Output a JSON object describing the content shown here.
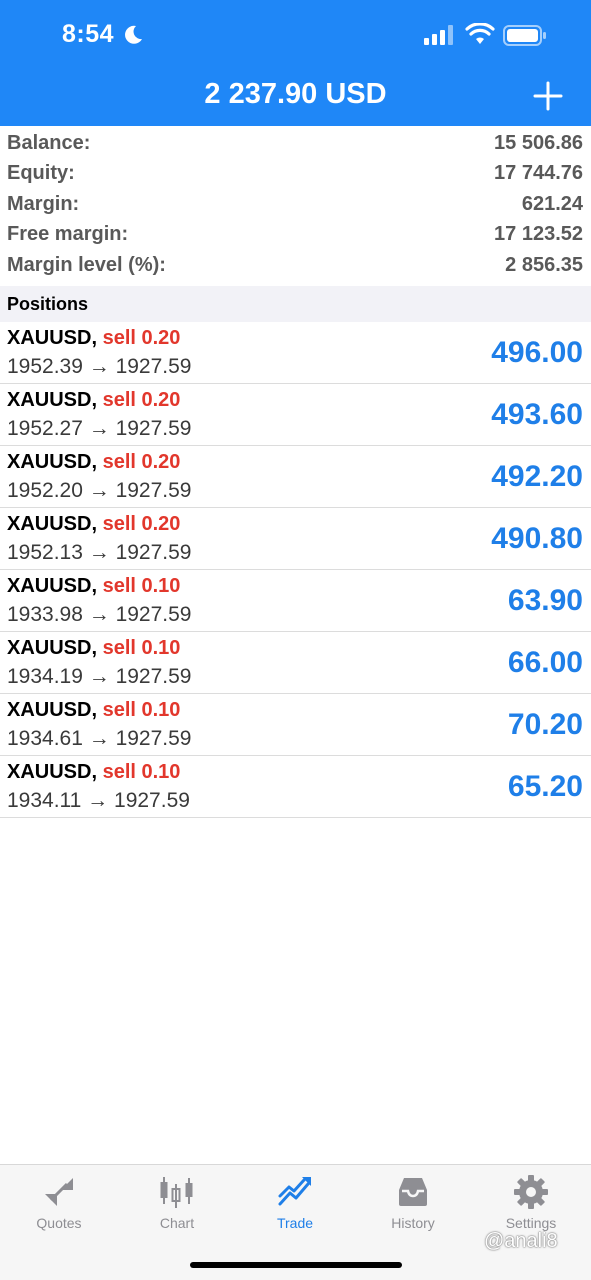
{
  "status_bar": {
    "time": "8:54"
  },
  "header": {
    "title": "2 237.90 USD"
  },
  "summary": [
    {
      "label": "Balance:",
      "value": "15 506.86"
    },
    {
      "label": "Equity:",
      "value": "17 744.76"
    },
    {
      "label": "Margin:",
      "value": "621.24"
    },
    {
      "label": "Free margin:",
      "value": "17 123.52"
    },
    {
      "label": "Margin level (%):",
      "value": "2 856.35"
    }
  ],
  "positions_title": "Positions",
  "positions": [
    {
      "symbol": "XAUUSD,",
      "side": "sell 0.20",
      "prices": "1952.39 → 1927.59",
      "profit": "496.00"
    },
    {
      "symbol": "XAUUSD,",
      "side": "sell 0.20",
      "prices": "1952.27 → 1927.59",
      "profit": "493.60"
    },
    {
      "symbol": "XAUUSD,",
      "side": "sell 0.20",
      "prices": "1952.20 → 1927.59",
      "profit": "492.20"
    },
    {
      "symbol": "XAUUSD,",
      "side": "sell 0.20",
      "prices": "1952.13 → 1927.59",
      "profit": "490.80"
    },
    {
      "symbol": "XAUUSD,",
      "side": "sell 0.10",
      "prices": "1933.98 → 1927.59",
      "profit": "63.90"
    },
    {
      "symbol": "XAUUSD,",
      "side": "sell 0.10",
      "prices": "1934.19 → 1927.59",
      "profit": "66.00"
    },
    {
      "symbol": "XAUUSD,",
      "side": "sell 0.10",
      "prices": "1934.61 → 1927.59",
      "profit": "70.20"
    },
    {
      "symbol": "XAUUSD,",
      "side": "sell 0.10",
      "prices": "1934.11 → 1927.59",
      "profit": "65.20"
    }
  ],
  "tabs": [
    {
      "label": "Quotes",
      "icon": "quotes-icon",
      "active": false
    },
    {
      "label": "Chart",
      "icon": "chart-icon",
      "active": false
    },
    {
      "label": "Trade",
      "icon": "trade-icon",
      "active": true
    },
    {
      "label": "History",
      "icon": "history-icon",
      "active": false
    },
    {
      "label": "Settings",
      "icon": "settings-icon",
      "active": false
    }
  ],
  "watermark": "@anali8",
  "colors": {
    "header_bg": "#1f87f7",
    "sell": "#e2372c",
    "profit": "#1f7fe8",
    "active_tab": "#1f7fe8",
    "inactive_tab": "#8e8e93"
  }
}
